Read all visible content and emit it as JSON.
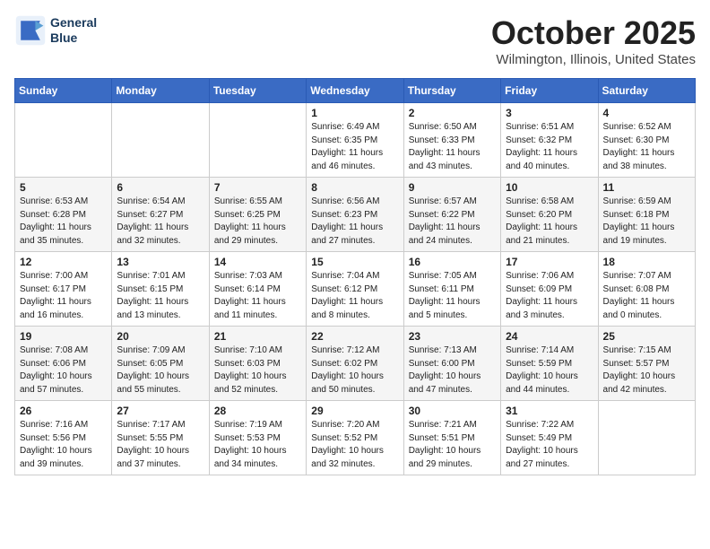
{
  "header": {
    "logo_line1": "General",
    "logo_line2": "Blue",
    "title": "October 2025",
    "location": "Wilmington, Illinois, United States"
  },
  "weekdays": [
    "Sunday",
    "Monday",
    "Tuesday",
    "Wednesday",
    "Thursday",
    "Friday",
    "Saturday"
  ],
  "weeks": [
    [
      {
        "day": "",
        "info": ""
      },
      {
        "day": "",
        "info": ""
      },
      {
        "day": "",
        "info": ""
      },
      {
        "day": "1",
        "info": "Sunrise: 6:49 AM\nSunset: 6:35 PM\nDaylight: 11 hours\nand 46 minutes."
      },
      {
        "day": "2",
        "info": "Sunrise: 6:50 AM\nSunset: 6:33 PM\nDaylight: 11 hours\nand 43 minutes."
      },
      {
        "day": "3",
        "info": "Sunrise: 6:51 AM\nSunset: 6:32 PM\nDaylight: 11 hours\nand 40 minutes."
      },
      {
        "day": "4",
        "info": "Sunrise: 6:52 AM\nSunset: 6:30 PM\nDaylight: 11 hours\nand 38 minutes."
      }
    ],
    [
      {
        "day": "5",
        "info": "Sunrise: 6:53 AM\nSunset: 6:28 PM\nDaylight: 11 hours\nand 35 minutes."
      },
      {
        "day": "6",
        "info": "Sunrise: 6:54 AM\nSunset: 6:27 PM\nDaylight: 11 hours\nand 32 minutes."
      },
      {
        "day": "7",
        "info": "Sunrise: 6:55 AM\nSunset: 6:25 PM\nDaylight: 11 hours\nand 29 minutes."
      },
      {
        "day": "8",
        "info": "Sunrise: 6:56 AM\nSunset: 6:23 PM\nDaylight: 11 hours\nand 27 minutes."
      },
      {
        "day": "9",
        "info": "Sunrise: 6:57 AM\nSunset: 6:22 PM\nDaylight: 11 hours\nand 24 minutes."
      },
      {
        "day": "10",
        "info": "Sunrise: 6:58 AM\nSunset: 6:20 PM\nDaylight: 11 hours\nand 21 minutes."
      },
      {
        "day": "11",
        "info": "Sunrise: 6:59 AM\nSunset: 6:18 PM\nDaylight: 11 hours\nand 19 minutes."
      }
    ],
    [
      {
        "day": "12",
        "info": "Sunrise: 7:00 AM\nSunset: 6:17 PM\nDaylight: 11 hours\nand 16 minutes."
      },
      {
        "day": "13",
        "info": "Sunrise: 7:01 AM\nSunset: 6:15 PM\nDaylight: 11 hours\nand 13 minutes."
      },
      {
        "day": "14",
        "info": "Sunrise: 7:03 AM\nSunset: 6:14 PM\nDaylight: 11 hours\nand 11 minutes."
      },
      {
        "day": "15",
        "info": "Sunrise: 7:04 AM\nSunset: 6:12 PM\nDaylight: 11 hours\nand 8 minutes."
      },
      {
        "day": "16",
        "info": "Sunrise: 7:05 AM\nSunset: 6:11 PM\nDaylight: 11 hours\nand 5 minutes."
      },
      {
        "day": "17",
        "info": "Sunrise: 7:06 AM\nSunset: 6:09 PM\nDaylight: 11 hours\nand 3 minutes."
      },
      {
        "day": "18",
        "info": "Sunrise: 7:07 AM\nSunset: 6:08 PM\nDaylight: 11 hours\nand 0 minutes."
      }
    ],
    [
      {
        "day": "19",
        "info": "Sunrise: 7:08 AM\nSunset: 6:06 PM\nDaylight: 10 hours\nand 57 minutes."
      },
      {
        "day": "20",
        "info": "Sunrise: 7:09 AM\nSunset: 6:05 PM\nDaylight: 10 hours\nand 55 minutes."
      },
      {
        "day": "21",
        "info": "Sunrise: 7:10 AM\nSunset: 6:03 PM\nDaylight: 10 hours\nand 52 minutes."
      },
      {
        "day": "22",
        "info": "Sunrise: 7:12 AM\nSunset: 6:02 PM\nDaylight: 10 hours\nand 50 minutes."
      },
      {
        "day": "23",
        "info": "Sunrise: 7:13 AM\nSunset: 6:00 PM\nDaylight: 10 hours\nand 47 minutes."
      },
      {
        "day": "24",
        "info": "Sunrise: 7:14 AM\nSunset: 5:59 PM\nDaylight: 10 hours\nand 44 minutes."
      },
      {
        "day": "25",
        "info": "Sunrise: 7:15 AM\nSunset: 5:57 PM\nDaylight: 10 hours\nand 42 minutes."
      }
    ],
    [
      {
        "day": "26",
        "info": "Sunrise: 7:16 AM\nSunset: 5:56 PM\nDaylight: 10 hours\nand 39 minutes."
      },
      {
        "day": "27",
        "info": "Sunrise: 7:17 AM\nSunset: 5:55 PM\nDaylight: 10 hours\nand 37 minutes."
      },
      {
        "day": "28",
        "info": "Sunrise: 7:19 AM\nSunset: 5:53 PM\nDaylight: 10 hours\nand 34 minutes."
      },
      {
        "day": "29",
        "info": "Sunrise: 7:20 AM\nSunset: 5:52 PM\nDaylight: 10 hours\nand 32 minutes."
      },
      {
        "day": "30",
        "info": "Sunrise: 7:21 AM\nSunset: 5:51 PM\nDaylight: 10 hours\nand 29 minutes."
      },
      {
        "day": "31",
        "info": "Sunrise: 7:22 AM\nSunset: 5:49 PM\nDaylight: 10 hours\nand 27 minutes."
      },
      {
        "day": "",
        "info": ""
      }
    ]
  ]
}
